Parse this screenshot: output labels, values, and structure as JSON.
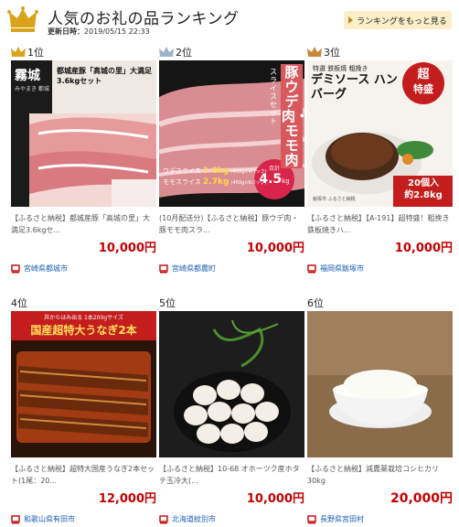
{
  "header": {
    "title": "人気のお礼の品ランキング",
    "updated_label": "更新日時：",
    "updated_value": "2019/05/15 22:33",
    "more_button": "ランキングをもっと見る"
  },
  "colors": {
    "gold": "#d9a419",
    "silver": "#9fb3c8",
    "bronze": "#c8873a",
    "price": "#c40000",
    "link": "#1a5fb4"
  },
  "items": [
    {
      "rank": "1位",
      "image_text": {
        "brand": "霧城",
        "maker": "みやまき 都城",
        "headline": "都城産豚「高城の里」大満足 3.6kgセット"
      },
      "description": "【ふるさと納税】都城産豚「高城の里」大満足3.6kgセ...",
      "price": "10,000円",
      "location": "宮崎県都城市"
    },
    {
      "rank": "2位",
      "image_text": {
        "headline": "豚ウデ肉・モモ肉",
        "sub": "スライスセット",
        "row1_label": "ウデスライス",
        "row1_value": "1.8kg",
        "row1_note": "(450g×4パック)",
        "row2_label": "モモスライス",
        "row2_value": "2.7kg",
        "row2_note": "(450g×6パック)",
        "total_label": "合計",
        "total_value": "4.5",
        "total_unit": "kg"
      },
      "description": "(10月配送分)【ふるさと納税】豚ウデ肉・豚モモ肉スラ...",
      "price": "10,000円",
      "location": "宮崎県都農町"
    },
    {
      "rank": "3位",
      "image_text": {
        "kicker": "特選 鉄板焼 粗挽き",
        "headline": "デミソース ハンバーグ",
        "badge_top": "超",
        "badge_bottom": "特盛",
        "count": "20個入",
        "weight": "約2.8kg",
        "maker": "飯塚市 ふるさと納税"
      },
      "description": "【ふるさと納税】【A-191】超特盛！粗挽き鉄板焼きハ...",
      "price": "10,000円",
      "location": "福岡県飯塚市"
    },
    {
      "rank": "4位",
      "image_text": {
        "kicker": "丼からはみ出る 1本200gサイズ",
        "headline": "国産超特大うなぎ2本"
      },
      "description": "【ふるさと納税】超特大国産うなぎ2本セット(1尾：20...",
      "price": "12,000円",
      "location": "和歌山県有田市"
    },
    {
      "rank": "5位",
      "image_text": {},
      "description": "【ふるさと納税】10-68 オホーツク産ホタテ玉冷大(...",
      "price": "10,000円",
      "location": "北海道紋別市"
    },
    {
      "rank": "6位",
      "image_text": {},
      "description": "【ふるさと納税】減農薬栽培コシヒカリ30kg",
      "price": "20,000円",
      "location": "長野県宮田村"
    }
  ]
}
